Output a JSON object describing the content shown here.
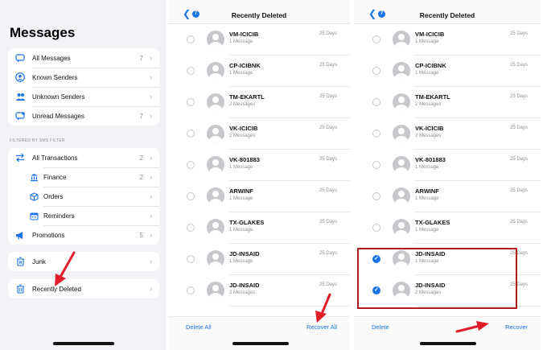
{
  "screen1": {
    "title": "Messages",
    "groups": [
      {
        "items": [
          {
            "label": "All Messages",
            "count": "7",
            "icon": "chat-bubble-icon"
          },
          {
            "label": "Known Senders",
            "count": "",
            "icon": "person-icon"
          },
          {
            "label": "Unknown Senders",
            "count": "",
            "icon": "unknown-people-icon"
          },
          {
            "label": "Unread Messages",
            "count": "7",
            "icon": "unread-bubble-icon"
          }
        ]
      }
    ],
    "filter_header": "FILTERED BY SMS FILTER",
    "filter_items": [
      {
        "label": "All Transactions",
        "count": "2",
        "icon": "transfer-arrows-icon",
        "sub": false
      },
      {
        "label": "Finance",
        "count": "2",
        "icon": "finance-icon",
        "sub": true
      },
      {
        "label": "Orders",
        "count": "",
        "icon": "box-icon",
        "sub": true
      },
      {
        "label": "Reminders",
        "count": "",
        "icon": "calendar-icon",
        "sub": true
      },
      {
        "label": "Promotions",
        "count": "5",
        "icon": "megaphone-icon",
        "sub": false
      }
    ],
    "junk": {
      "label": "Junk",
      "icon": "trash-x-icon"
    },
    "recently_deleted": {
      "label": "Recently Deleted",
      "icon": "trash-icon"
    }
  },
  "screen2": {
    "back_badge": "7",
    "title": "Recently Deleted",
    "rows": [
      {
        "name": "VM-ICICIB",
        "sub": "1 Message",
        "days": "25 Days",
        "checked": false
      },
      {
        "name": "CP-ICIBNK",
        "sub": "1 Message",
        "days": "25 Days",
        "checked": false
      },
      {
        "name": "TM-EKARTL",
        "sub": "2 Messages",
        "days": "25 Days",
        "checked": false
      },
      {
        "name": "VK-ICICIB",
        "sub": "2 Messages",
        "days": "25 Days",
        "checked": false
      },
      {
        "name": "VK-801883",
        "sub": "1 Message",
        "days": "25 Days",
        "checked": false
      },
      {
        "name": "ARWINF",
        "sub": "1 Message",
        "days": "25 Days",
        "checked": false
      },
      {
        "name": "TX-GLAKES",
        "sub": "1 Message",
        "days": "25 Days",
        "checked": false
      },
      {
        "name": "JD-INSAID",
        "sub": "1 Message",
        "days": "25 Days",
        "checked": false
      },
      {
        "name": "JD-INSAID",
        "sub": "2 Messages",
        "days": "25 Days",
        "checked": false
      }
    ],
    "footer_left": "Delete All",
    "footer_right": "Recover All"
  },
  "screen3": {
    "back_badge": "7",
    "title": "Recently Deleted",
    "rows": [
      {
        "name": "VM-ICICIB",
        "sub": "1 Message",
        "days": "25 Days",
        "checked": false
      },
      {
        "name": "CP-ICIBNK",
        "sub": "1 Message",
        "days": "25 Days",
        "checked": false
      },
      {
        "name": "TM-EKARTL",
        "sub": "2 Messages",
        "days": "25 Days",
        "checked": false
      },
      {
        "name": "VK-ICICIB",
        "sub": "2 Messages",
        "days": "25 Days",
        "checked": false
      },
      {
        "name": "VK-801883",
        "sub": "1 Message",
        "days": "25 Days",
        "checked": false
      },
      {
        "name": "ARWINF",
        "sub": "1 Message",
        "days": "25 Days",
        "checked": false
      },
      {
        "name": "TX-GLAKES",
        "sub": "1 Message",
        "days": "25 Days",
        "checked": false
      },
      {
        "name": "JD-INSAID",
        "sub": "1 Message",
        "days": "25 Days",
        "checked": true
      },
      {
        "name": "JD-INSAID",
        "sub": "2 Messages",
        "days": "25 Days",
        "checked": true
      }
    ],
    "footer_left": "Delete",
    "footer_right": "Recover"
  },
  "colors": {
    "accent": "#1a73e8",
    "annotation": "#e11d2a",
    "highlight_border": "#b11b1b"
  }
}
